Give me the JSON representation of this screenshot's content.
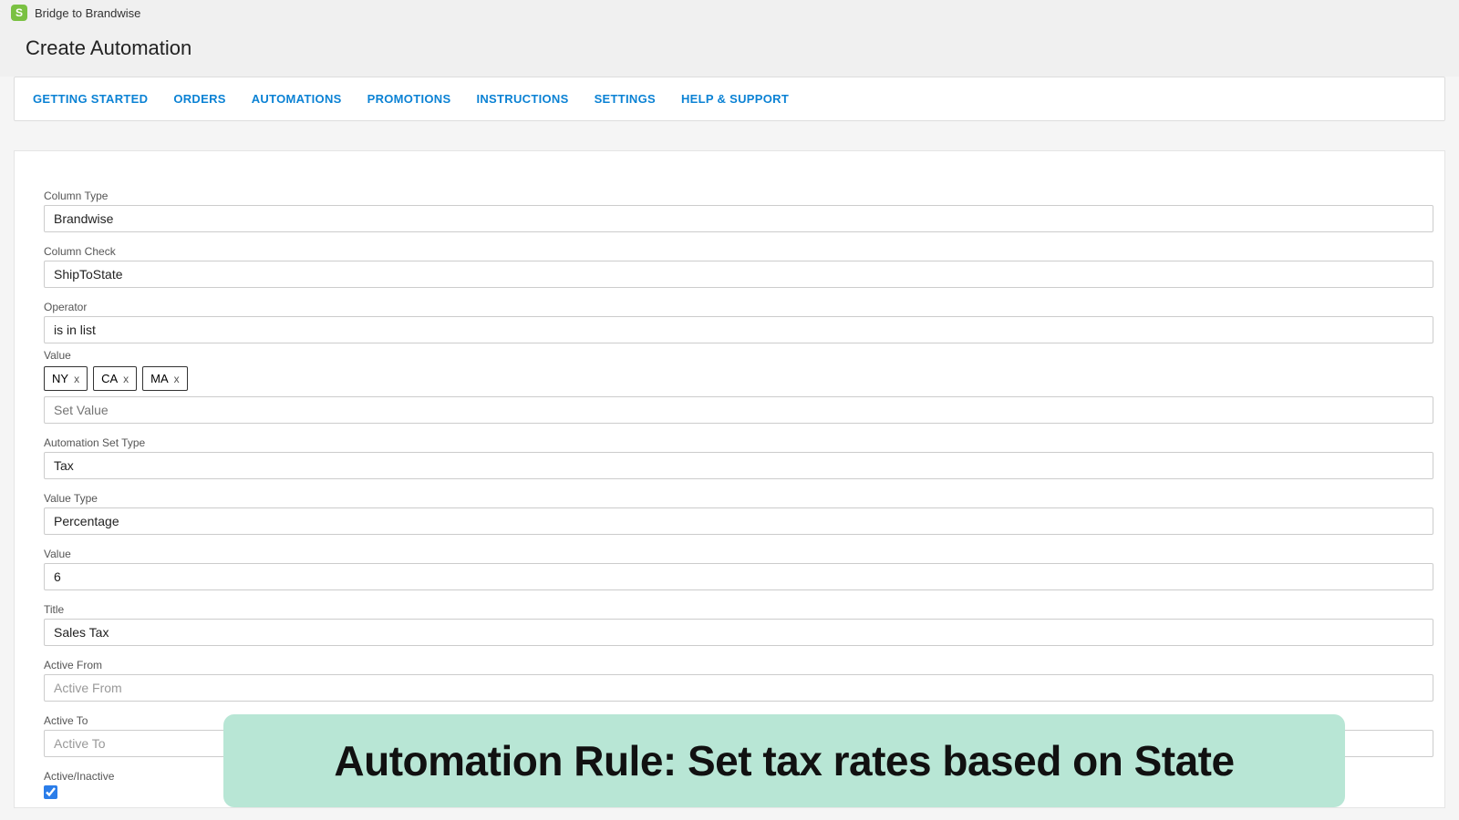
{
  "header": {
    "app_name": "Bridge to Brandwise",
    "page_title": "Create Automation"
  },
  "nav": {
    "items": [
      "GETTING STARTED",
      "ORDERS",
      "AUTOMATIONS",
      "PROMOTIONS",
      "INSTRUCTIONS",
      "SETTINGS",
      "HELP & SUPPORT"
    ]
  },
  "form": {
    "column_type": {
      "label": "Column Type",
      "value": "Brandwise"
    },
    "column_check": {
      "label": "Column Check",
      "value": "ShipToState"
    },
    "operator": {
      "label": "Operator",
      "value": "is in list"
    },
    "value_tags": {
      "label": "Value",
      "tags": [
        "NY",
        "CA",
        "MA"
      ],
      "placeholder": "Set Value"
    },
    "automation_set_type": {
      "label": "Automation Set Type",
      "value": "Tax"
    },
    "value_type": {
      "label": "Value Type",
      "value": "Percentage"
    },
    "value_num": {
      "label": "Value",
      "value": "6"
    },
    "title": {
      "label": "Title",
      "value": "Sales Tax"
    },
    "active_from": {
      "label": "Active From",
      "placeholder": "Active From",
      "value": ""
    },
    "active_to": {
      "label": "Active To",
      "placeholder": "Active To",
      "value": ""
    },
    "active_toggle": {
      "label": "Active/Inactive",
      "checked": true
    }
  },
  "overlay": {
    "text": "Automation Rule: Set tax rates based on State"
  }
}
